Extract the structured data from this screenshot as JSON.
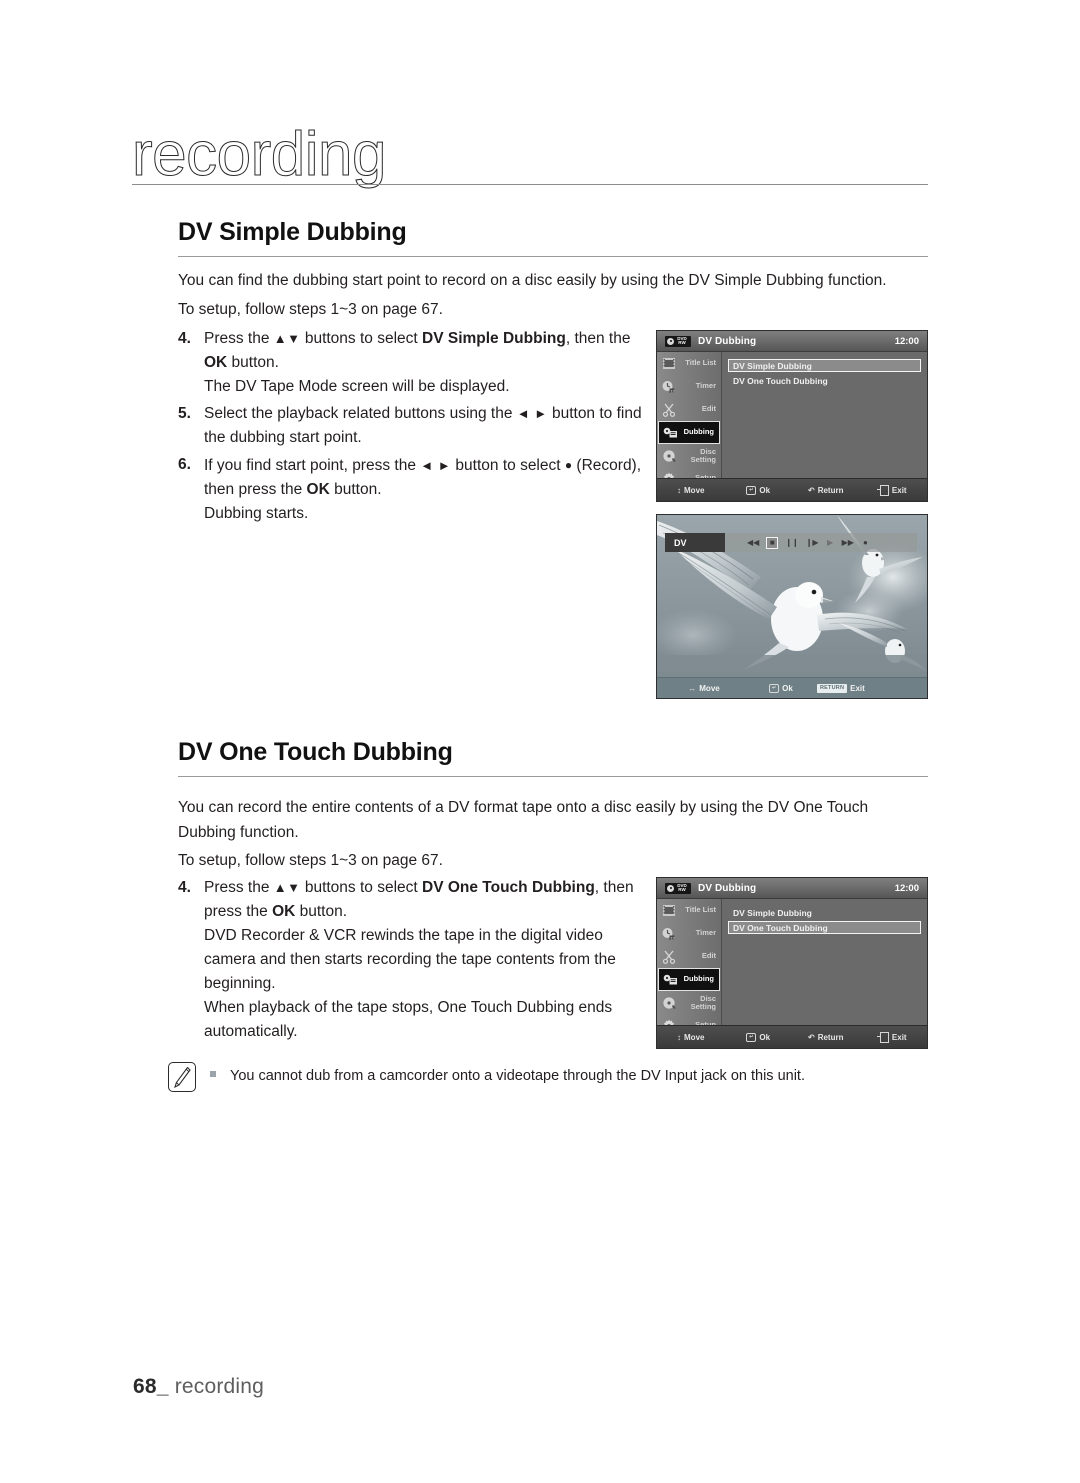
{
  "chapter": {
    "title": "recording"
  },
  "sections": [
    {
      "heading": "DV Simple Dubbing",
      "intro": "You can find the dubbing start point to record on a disc easily by using the DV Simple Dubbing function.",
      "setup": "To setup, follow steps 1~3 on page 67.",
      "steps": [
        {
          "num": "4.",
          "lines": [
            "Press the ▲▼ buttons to select DV Simple Dubbing, then the OK button.",
            "The DV Tape Mode screen will be displayed."
          ]
        },
        {
          "num": "5.",
          "lines": [
            "Select the playback related buttons using the ◄ ► button to find the dubbing start point."
          ]
        },
        {
          "num": "6.",
          "lines": [
            "If you find start point, press the ◄ ► button to select ● (Record), then press the OK button.",
            "Dubbing starts."
          ]
        }
      ]
    },
    {
      "heading": "DV One Touch Dubbing",
      "intro": "You can record the entire contents of a DV format tape onto a disc easily by using the DV One Touch Dubbing function.",
      "setup": "To setup, follow steps 1~3 on page 67.",
      "steps": [
        {
          "num": "4.",
          "lines": [
            "Press the ▲▼ buttons to select DV One Touch Dubbing, then press the OK button.",
            "DVD Recorder & VCR rewinds the tape in the digital video camera and then starts recording the tape contents from the beginning.",
            "When playback of the tape stops, One Touch Dubbing ends automatically."
          ]
        }
      ]
    }
  ],
  "osd_menu": {
    "disc_badge": {
      "line1": "DVD",
      "line2": "RW"
    },
    "title": "DV Dubbing",
    "clock": "12:00",
    "nav_items": [
      {
        "label": "Title List",
        "icon": "film-strip-icon"
      },
      {
        "label": "Timer",
        "icon": "timer-clock-icon"
      },
      {
        "label": "Edit",
        "icon": "scissors-icon"
      },
      {
        "label": "Dubbing",
        "icon": "dubbing-camera-icon"
      },
      {
        "label": "Disc Setting",
        "icon": "disc-icon"
      },
      {
        "label": "Setup",
        "icon": "gear-icon"
      }
    ],
    "options": [
      "DV Simple Dubbing",
      "DV One Touch Dubbing"
    ],
    "footer_keys": [
      {
        "label": "Move",
        "glyph": "↕"
      },
      {
        "label": "Ok",
        "glyph": "ok-key-icon"
      },
      {
        "label": "Return",
        "glyph": "↶"
      },
      {
        "label": "Exit",
        "glyph": "exit-key-icon"
      }
    ]
  },
  "osd_menu_1": {
    "selected_option": "DV Simple Dubbing",
    "selected_index": 0,
    "active_nav": "Dubbing"
  },
  "osd_menu_2": {
    "selected_option": "DV One Touch Dubbing",
    "selected_index": 1,
    "active_nav": "Dubbing"
  },
  "dv_screen": {
    "source_label": "DV",
    "transport": [
      {
        "name": "rewind",
        "glyph": "◀◀",
        "selected": false
      },
      {
        "name": "stop",
        "glyph": "■",
        "selected": true
      },
      {
        "name": "pause",
        "glyph": "❙❙",
        "selected": false
      },
      {
        "name": "frame-advance",
        "glyph": "❙▶",
        "selected": false
      },
      {
        "name": "play",
        "glyph": "▶",
        "selected": false
      },
      {
        "name": "fast-forward",
        "glyph": "▶▶",
        "selected": false
      },
      {
        "name": "record",
        "glyph": "●",
        "selected": false
      }
    ],
    "footer_keys": [
      {
        "label": "Move",
        "glyph": "↔"
      },
      {
        "label": "Ok",
        "glyph": "ok-key-icon"
      },
      {
        "label": "Exit",
        "glyph": "RETURN"
      }
    ]
  },
  "note": {
    "text": "You cannot dub from a camcorder onto a videotape through the DV Input jack on this unit."
  },
  "page_footer": {
    "number": "68",
    "separator": "_",
    "chapter": "recording"
  }
}
